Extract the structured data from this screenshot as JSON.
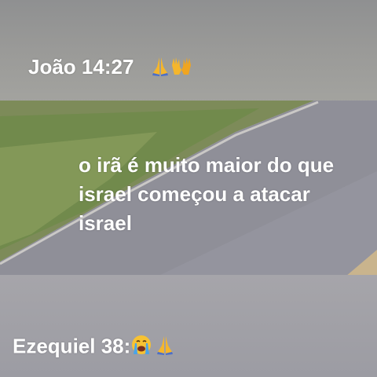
{
  "captions": {
    "top_ref": "João 14:27",
    "middle_line1": "o irã é muito maior do que",
    "middle_line2": "israel começou a atacar",
    "middle_line3": "israel",
    "bottom_ref": "Ezequiel 38:"
  },
  "icons": {
    "top": [
      "praying-hands-icon",
      "raising-hands-icon"
    ],
    "bottom": [
      "crying-face-icon",
      "praying-hands-icon"
    ]
  },
  "colors": {
    "caption_text": "#ffffff",
    "road": "#8f8f98",
    "grass": "#6f8a4a"
  }
}
